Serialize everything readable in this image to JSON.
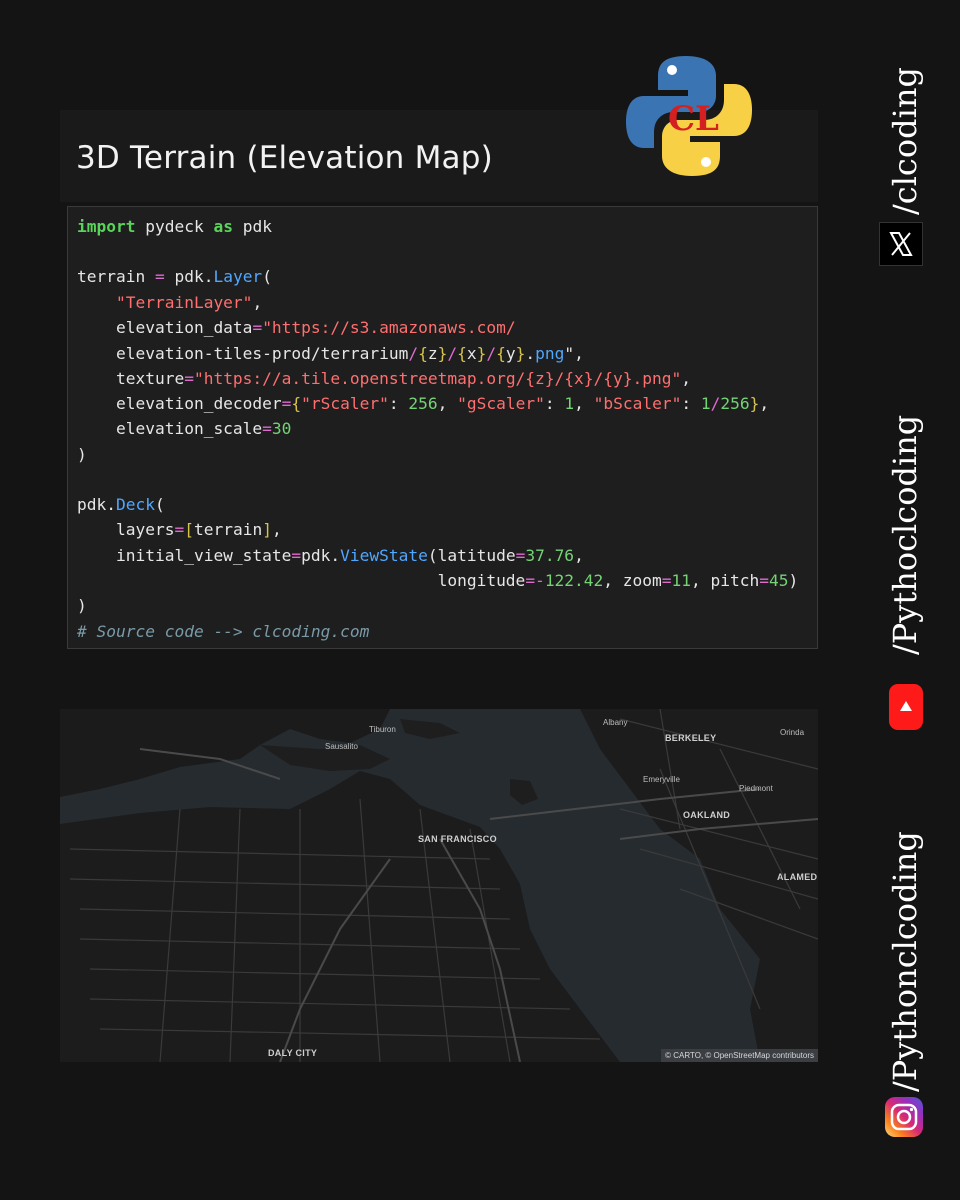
{
  "title": "3D Terrain (Elevation Map)",
  "logo": {
    "text": "CL"
  },
  "code": {
    "language": "python",
    "lines": [
      "import pydeck as pdk",
      "",
      "terrain = pdk.Layer(",
      "    \"TerrainLayer\",",
      "    elevation_data=\"https://s3.amazonaws.com/",
      "    elevation-tiles-prod/terrarium/{z}/{x}/{y}.png\",",
      "    texture=\"https://a.tile.openstreetmap.org/{z}/{x}/{y}.png\",",
      "    elevation_decoder={\"rScaler\": 256, \"gScaler\": 1, \"bScaler\": 1/256},",
      "    elevation_scale=30",
      ")",
      "",
      "pdk.Deck(",
      "    layers=[terrain],",
      "    initial_view_state=pdk.ViewState(latitude=37.76,",
      "                                     longitude=-122.42, zoom=11, pitch=45)",
      ")",
      "# Source code --> clcoding.com"
    ]
  },
  "map": {
    "labels": {
      "sausalito": "Sausalito",
      "tiburon": "Tiburon",
      "albany": "Albany",
      "berkeley": "BERKELEY",
      "orinda": "Orinda",
      "emeryville": "Emeryville",
      "piedmont": "Piedmont",
      "oakland": "OAKLAND",
      "san_francisco": "SAN FRANCISCO",
      "alameda": "ALAMED",
      "daly_city": "DALY CITY"
    },
    "attribution": "© CARTO, © OpenStreetMap contributors"
  },
  "social": {
    "x_handle": "/clcoding",
    "youtube_handle": "/Pythoclcoding",
    "instagram_handle": "/Pythonclcoding"
  },
  "colors": {
    "background": "#141414",
    "code_bg": "#1e1e1e",
    "keyword": "#5ad35a",
    "function": "#4fa7ff",
    "string": "#ff6f6f",
    "number": "#74d374",
    "operator": "#e06bd0",
    "brace": "#d7c24b",
    "comment": "#7a9aa8",
    "youtube_red": "#ff1a1a"
  }
}
